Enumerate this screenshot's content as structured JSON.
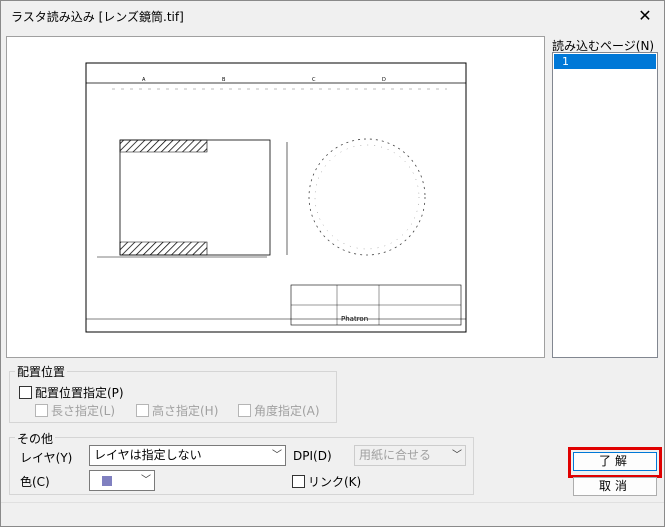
{
  "window": {
    "title": "ラスタ読み込み [レンズ鏡筒.tif]",
    "close_symbol": "✕"
  },
  "pages": {
    "label": "読み込むページ(N)",
    "items": [
      "1"
    ]
  },
  "placement": {
    "group_title": "配置位置",
    "specify_label": "配置位置指定(P)",
    "length_label": "長さ指定(L)",
    "height_label": "高さ指定(H)",
    "angle_label": "角度指定(A)"
  },
  "other": {
    "group_title": "その他",
    "layer_label": "レイヤ(Y)",
    "layer_value": "レイヤは指定しない",
    "dpi_label": "DPI(D)",
    "dpi_value": "用紙に合せる",
    "color_label": "色(C)",
    "color_swatch": "#8080c0",
    "link_label": "リンク(K)"
  },
  "buttons": {
    "ok": "了解",
    "cancel": "取消"
  },
  "preview": {
    "logo_text": "Phatron"
  }
}
